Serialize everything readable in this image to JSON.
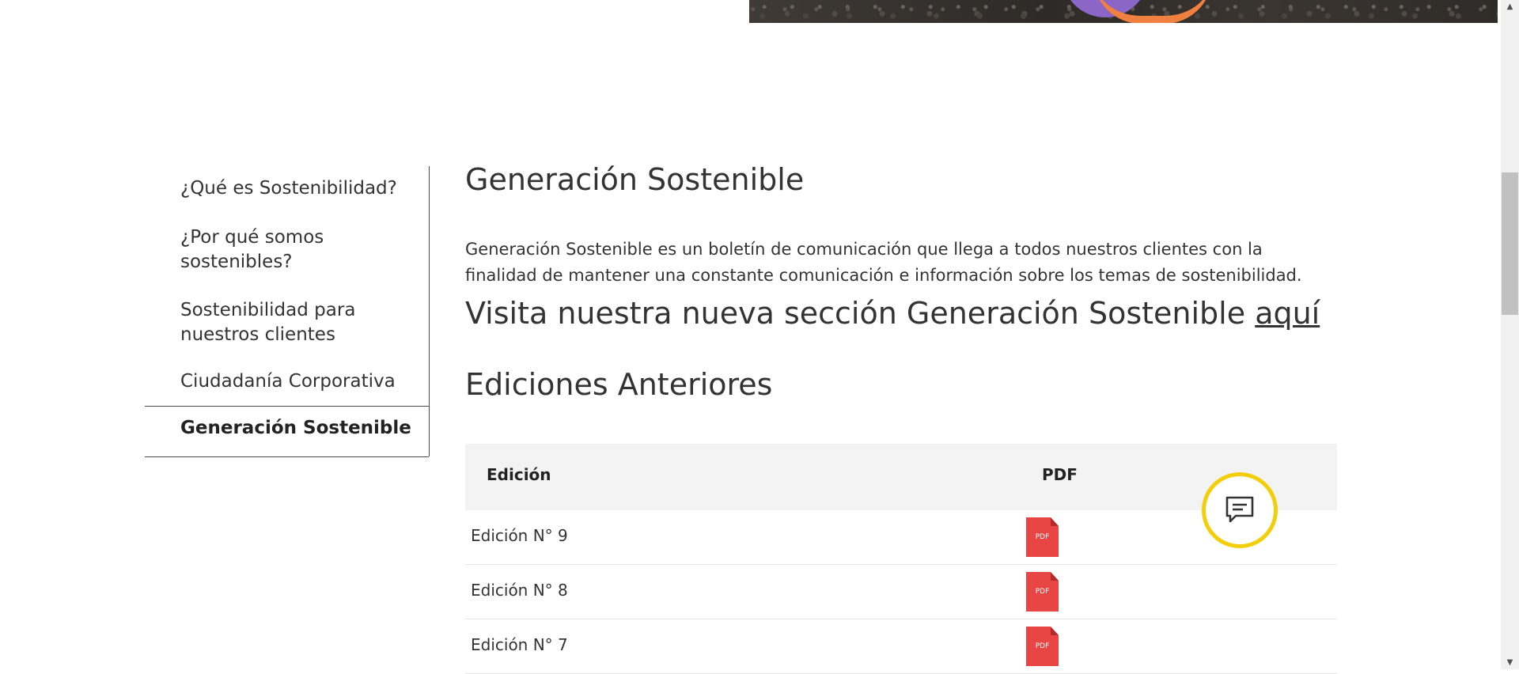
{
  "sidebar": {
    "items": [
      {
        "label": "¿Qué es Sostenibilidad?"
      },
      {
        "label": "¿Por qué somos sostenibles?"
      },
      {
        "label": "Sostenibilidad para nuestros clientes"
      },
      {
        "label": "Ciudadanía Corporativa"
      },
      {
        "label": "Generación Sostenible",
        "active": true
      }
    ]
  },
  "main": {
    "title": "Generación Sostenible",
    "description": "Generación Sostenible es un boletín de comunicación que llega a todos nuestros clientes con la finalidad de mantener una constante comunicación e información sobre los temas de sostenibilidad.",
    "visit_text": "Visita nuestra nueva sección Generación Sostenible ",
    "visit_link": "aquí",
    "editions_title": "Ediciones Anteriores"
  },
  "table": {
    "headers": [
      "Edición",
      "PDF"
    ],
    "rows": [
      {
        "edition": "Edición N° 9",
        "pdf_label": "PDF"
      },
      {
        "edition": "Edición N° 8",
        "pdf_label": "PDF"
      },
      {
        "edition": "Edición N° 7",
        "pdf_label": "PDF"
      }
    ]
  },
  "colors": {
    "pdf_red": "#e84545",
    "chat_ring": "#f2cf0a",
    "text": "#333333"
  },
  "icons": {
    "chat": "chat-bubble-icon",
    "pdf": "pdf-file-icon"
  }
}
